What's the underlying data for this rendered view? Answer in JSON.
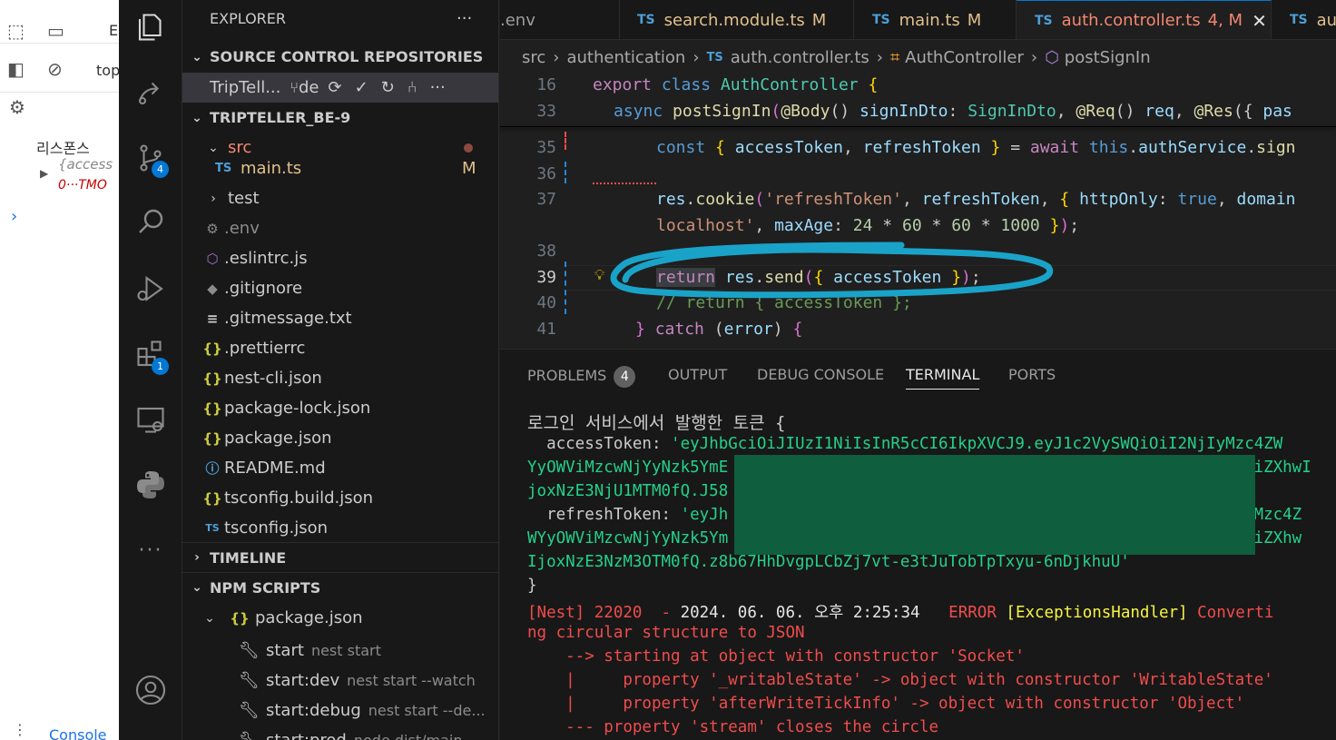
{
  "devtools": {
    "top_label": "top",
    "e_label": "E",
    "response_label": "리스폰스",
    "object_preview": "{access",
    "object_preview2": "0···TMO",
    "console_tab": "Console"
  },
  "activity_bar": {
    "scm_badge": "4",
    "extensions_badge": "1"
  },
  "sidebar": {
    "title": "EXPLORER",
    "more": "···",
    "scm_section": "SOURCE CONTROL REPOSITORIES",
    "repo_name": "TripTell...",
    "repo_branch": "de",
    "project_section": "TRIPTELLER_BE-9",
    "folder_src": "src",
    "file_main": "main.ts",
    "file_main_status": "M",
    "folder_test": "test",
    "files": [
      ".env",
      ".eslintrc.js",
      ".gitignore",
      ".gitmessage.txt",
      ".prettierrc",
      "nest-cli.json",
      "package-lock.json",
      "package.json",
      "README.md",
      "tsconfig.build.json",
      "tsconfig.json"
    ],
    "timeline_section": "TIMELINE",
    "npm_section": "NPM SCRIPTS",
    "npm_package": "package.json",
    "scripts": [
      {
        "name": "start",
        "cmd": "nest start"
      },
      {
        "name": "start:dev",
        "cmd": "nest start --watch"
      },
      {
        "name": "start:debug",
        "cmd": "nest start --de..."
      },
      {
        "name": "start:prod",
        "cmd": "node dist/main"
      }
    ]
  },
  "tabs": [
    {
      "label": ".env",
      "icon": ""
    },
    {
      "label": "search.module.ts",
      "icon": "TS",
      "status": "M"
    },
    {
      "label": "main.ts",
      "icon": "TS",
      "status": "M"
    },
    {
      "label": "auth.controller.ts",
      "icon": "TS",
      "status": "4, M"
    },
    {
      "label": "aut",
      "icon": "TS"
    }
  ],
  "breadcrumb": {
    "part1": "src",
    "part2": "authentication",
    "part3": "auth.controller.ts",
    "part4": "AuthController",
    "part5": "postSignIn"
  },
  "code": {
    "line_numbers": [
      "16",
      "33",
      "35",
      "36",
      "37",
      "",
      "38",
      "39",
      "40",
      "41"
    ]
  },
  "panel": {
    "tabs": [
      "PROBLEMS",
      "OUTPUT",
      "DEBUG CONSOLE",
      "TERMINAL",
      "PORTS"
    ],
    "problems_count": "4",
    "terminal": {
      "line1": "로그인 서비스에서 발행한 토큰 {",
      "access_key": "  accessToken: ",
      "access_val1": "'eyJhbGciOiJIUzI1NiIsInR5cCI6IkpXVCJ9.eyJ1c2VySWQiOiI2NjIyMzc4ZW",
      "access_val2": "YyOWViMzcwNjYyNzk5YmE",
      "access_val2_end": "wiZXhwI",
      "access_val3": "joxNzE3NjU1MTM0fQ.J58",
      "refresh_key": "  refreshToken: ",
      "refresh_val1": "'eyJh",
      "refresh_val1_end": "yMzc4Z",
      "refresh_val2": "WYyOWViMzcwNjYyNzk5Ym",
      "refresh_val2_end": "wiZXhw",
      "refresh_val3": "IjoxNzE3NzM3OTM0fQ.z8b67HhDvgpLCbZj7vt-e3tJuTobTpTxyu-6nDjkhuU'",
      "close": "}",
      "nest": "[Nest] 22020  - ",
      "timestamp": "2024. 06. 06. 오후 2:25:34",
      "error_label": "   ERROR ",
      "handler": "[ExceptionsHandler]",
      "msg1": " Converti",
      "msg2": "ng circular structure to JSON",
      "trace1": "    --> starting at object with constructor 'Socket'",
      "trace2": "    |     property '_writableState' -> object with constructor 'WritableState'",
      "trace3": "    |     property 'afterWriteTickInfo' -> object with constructor 'Object'",
      "trace4": "    --- property 'stream' closes the circle"
    }
  },
  "colors": {
    "accent": "#0078d4",
    "highlight_circle": "#1aa3c8",
    "error": "#f14c4c",
    "terminal_green": "#23d18b"
  }
}
